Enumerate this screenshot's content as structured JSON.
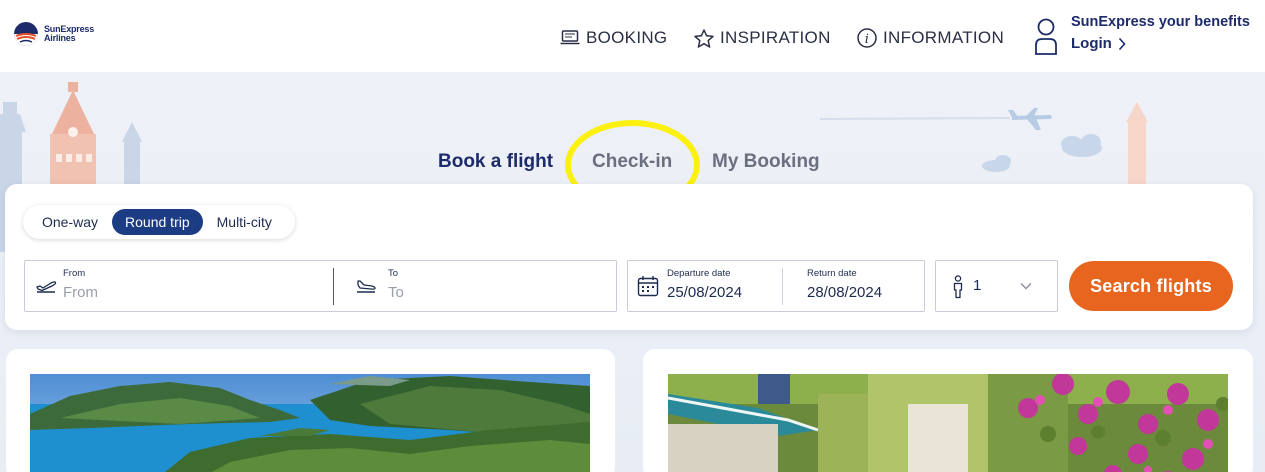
{
  "brand": {
    "line1": "SunExpress",
    "line2": "Airlines"
  },
  "nav": [
    {
      "label": "BOOKING",
      "icon": "laptop-icon"
    },
    {
      "label": "INSPIRATION",
      "icon": "star-icon"
    },
    {
      "label": "INFORMATION",
      "icon": "info-icon"
    }
  ],
  "account": {
    "title": "SunExpress your benefits",
    "login": "Login"
  },
  "tabs": {
    "book": "Book a flight",
    "checkin": "Check-in",
    "mybooking": "My Booking"
  },
  "trip_types": {
    "oneway": "One-way",
    "round": "Round trip",
    "multi": "Multi-city",
    "selected": "Round trip"
  },
  "search": {
    "from_label": "From",
    "from_placeholder": "From",
    "to_label": "To",
    "to_placeholder": "To",
    "departure_label": "Departure date",
    "departure_value": "25/08/2024",
    "return_label": "Return date",
    "return_value": "28/08/2024",
    "passengers": "1",
    "button": "Search flights"
  },
  "colors": {
    "brand_navy": "#1c3c84",
    "cta_orange": "#e8651f",
    "highlight": "#fbf00f"
  }
}
